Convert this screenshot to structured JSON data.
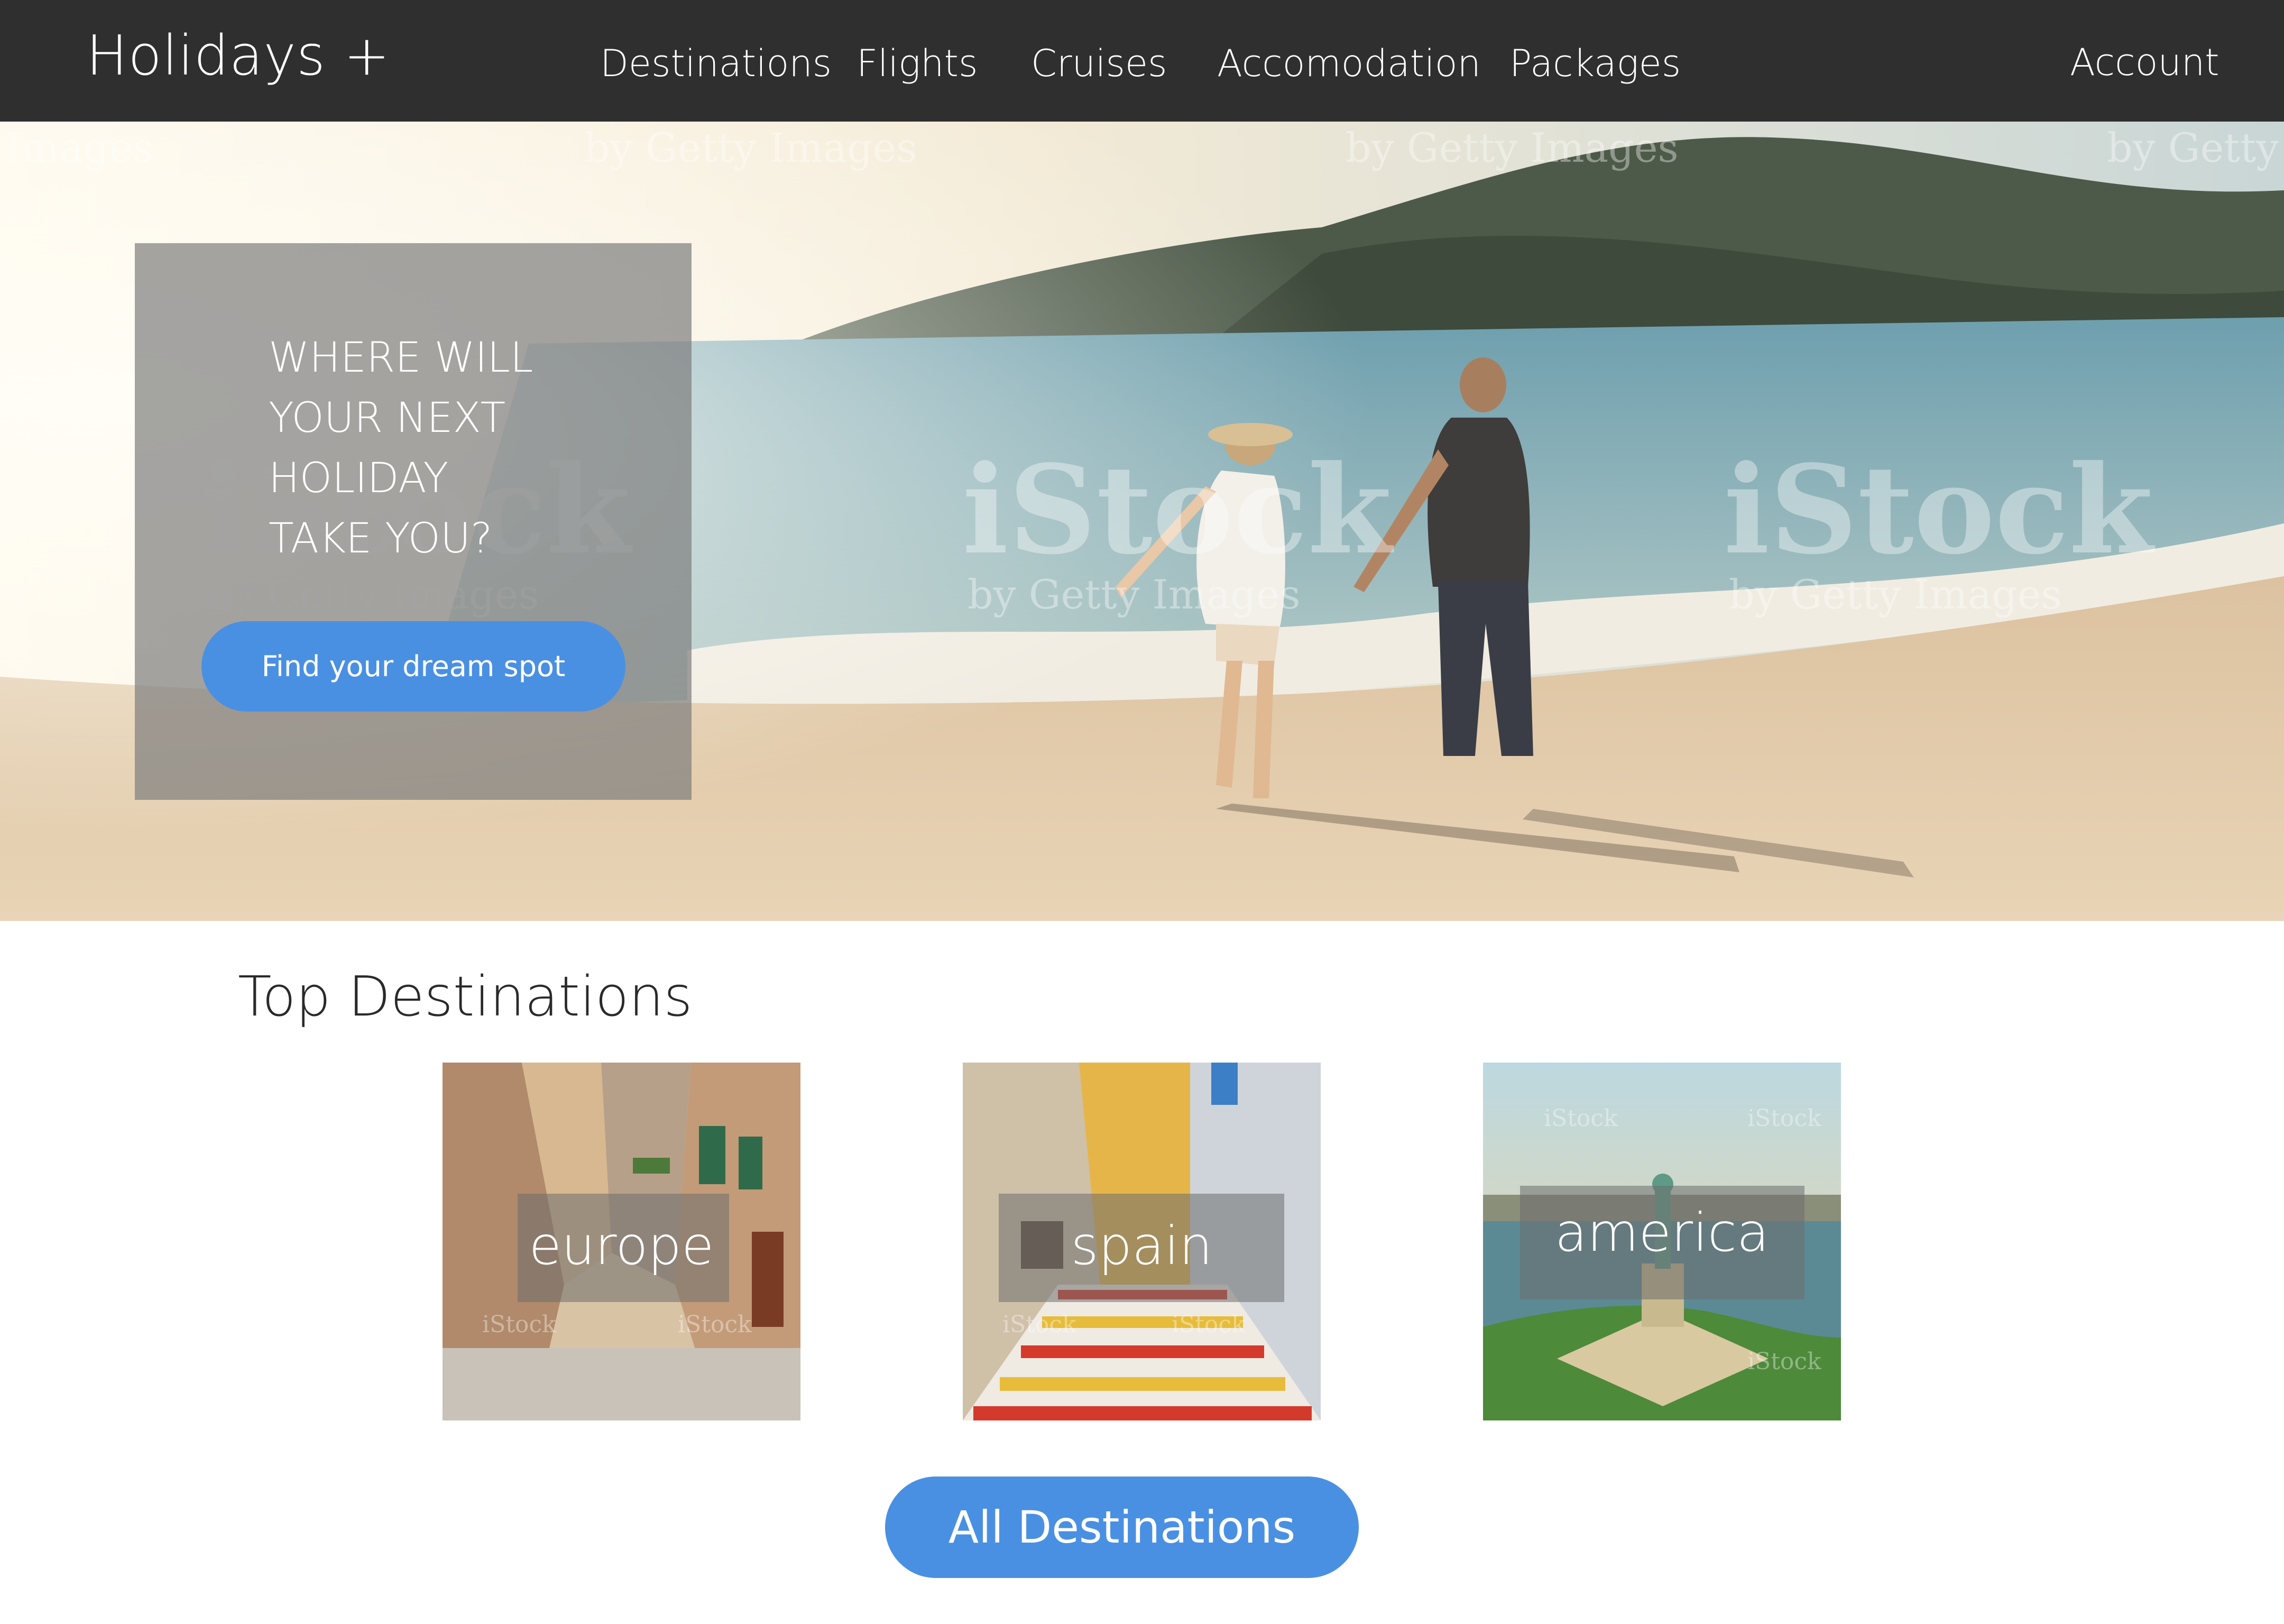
{
  "nav": {
    "logo": "Holidays +",
    "links": [
      "Destinations",
      "Flights",
      "Cruises",
      "Accomodation",
      "Packages"
    ],
    "account": "Account"
  },
  "hero": {
    "heading": "WHERE WILL\nYOUR NEXT\nHOLIDAY\nTAKE YOU?",
    "cta_label": "Find your dream spot",
    "watermark_brand": "iStock",
    "watermark_byline": "by Getty Images",
    "watermark_images": "Images",
    "watermark_getty": "by Getty"
  },
  "destinations": {
    "title": "Top Destinations",
    "items": [
      {
        "label": "europe"
      },
      {
        "label": "spain"
      },
      {
        "label": "america"
      }
    ],
    "watermark_brand": "iStock",
    "all_label": "All Destinations"
  },
  "colors": {
    "navbar": "#2f2f2f",
    "accent": "#4a90e2",
    "card_overlay": "#7d7d7d"
  }
}
